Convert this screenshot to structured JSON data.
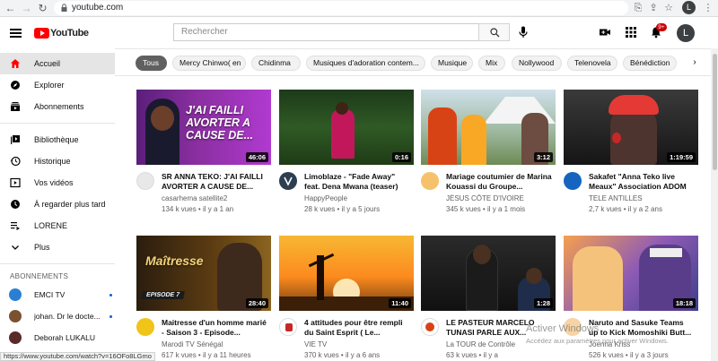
{
  "browser": {
    "url": "youtube.com",
    "profile_initial": "L"
  },
  "masthead": {
    "logo_text": "YouTube",
    "search_placeholder": "Rechercher",
    "notification_count": "9+",
    "avatar_initial": "L"
  },
  "sidebar": {
    "primary": [
      {
        "label": "Accueil",
        "icon": "home-icon",
        "active": true
      },
      {
        "label": "Explorer",
        "icon": "compass-icon"
      },
      {
        "label": "Abonnements",
        "icon": "subscriptions-icon"
      }
    ],
    "library": [
      {
        "label": "Bibliothèque",
        "icon": "library-icon"
      },
      {
        "label": "Historique",
        "icon": "history-icon"
      },
      {
        "label": "Vos vidéos",
        "icon": "your-videos-icon"
      },
      {
        "label": "À regarder plus tard",
        "icon": "watch-later-icon"
      },
      {
        "label": "LORENE",
        "icon": "playlist-icon"
      },
      {
        "label": "Plus",
        "icon": "chevron-down-icon"
      }
    ],
    "subscriptions_heading": "ABONNEMENTS",
    "subscriptions": [
      {
        "label": "EMCI TV",
        "color": "#2a7fd4",
        "new": true
      },
      {
        "label": "johan. Dr le docte...",
        "color": "#7a5230",
        "new": true
      },
      {
        "label": "Deborah LUKALU",
        "color": "#5a2a2a",
        "new": false
      }
    ]
  },
  "chips": [
    "Tous",
    "Mercy Chinwo( en",
    "Chidinma",
    "Musiques d'adoration contem...",
    "Musique",
    "Mix",
    "Nollywood",
    "Telenovela",
    "Bénédiction"
  ],
  "videos": [
    {
      "title": "SR ANNA TEKO: J'AI FAILLI AVORTER A CAUSE DE...",
      "channel": "casarhema satellite2",
      "meta": "134 k vues • il y a 1 an",
      "duration": "46:06",
      "thumb_text": "J'AI FAILLI AVORTER A CAUSE DE..."
    },
    {
      "title": "Limoblaze - \"Fade Away\" feat. Dena Mwana (teaser)",
      "channel": "HappyPeople",
      "meta": "28 k vues • il y a 5 jours",
      "duration": "0:16"
    },
    {
      "title": "Mariage coutumier de Marina Kouassi du Groupe...",
      "channel": "JÉSUS CÔTE D'IVOIRE",
      "meta": "345 k vues • il y a 1 mois",
      "duration": "3:12"
    },
    {
      "title": "Sakafet \"Anna Teko live Meaux\" Association ADOM",
      "channel": "TELE ANTILLES",
      "meta": "2,7 k vues • il y a 2 ans",
      "duration": "1:19:59"
    },
    {
      "title": "Maitresse d'un homme marié - Saison 3 - Episode...",
      "channel": "Marodi TV Sénégal",
      "meta": "617 k vues • il y a 11 heures",
      "duration": "28:40",
      "thumb_text": "Maîtresse",
      "thumb_badge": "EPISODE 7"
    },
    {
      "title": "4 attitudes pour être rempli du Saint Esprit ( Le...",
      "channel": "VIE TV",
      "meta": "370 k vues • il y a 6 ans",
      "duration": "11:40"
    },
    {
      "title": "LE PASTEUR MARCELO TUNASI PARLE AUX...",
      "channel": "La TOUR de Contrôle",
      "meta": "63 k vues • il y a",
      "duration": "1:28"
    },
    {
      "title": "Naruto and Sasuke Teams up to Kick Momoshiki Butt...",
      "channel": "Joenna Kriss",
      "meta": "526 k vues • il y a 3 jours",
      "duration": "18:18"
    }
  ],
  "status_url": "https://www.youtube.com/watch?v=16OFo8LGmo",
  "watermark": {
    "line1": "Activer Windows",
    "line2": "Accédez aux paramètres pour activer Windows."
  }
}
